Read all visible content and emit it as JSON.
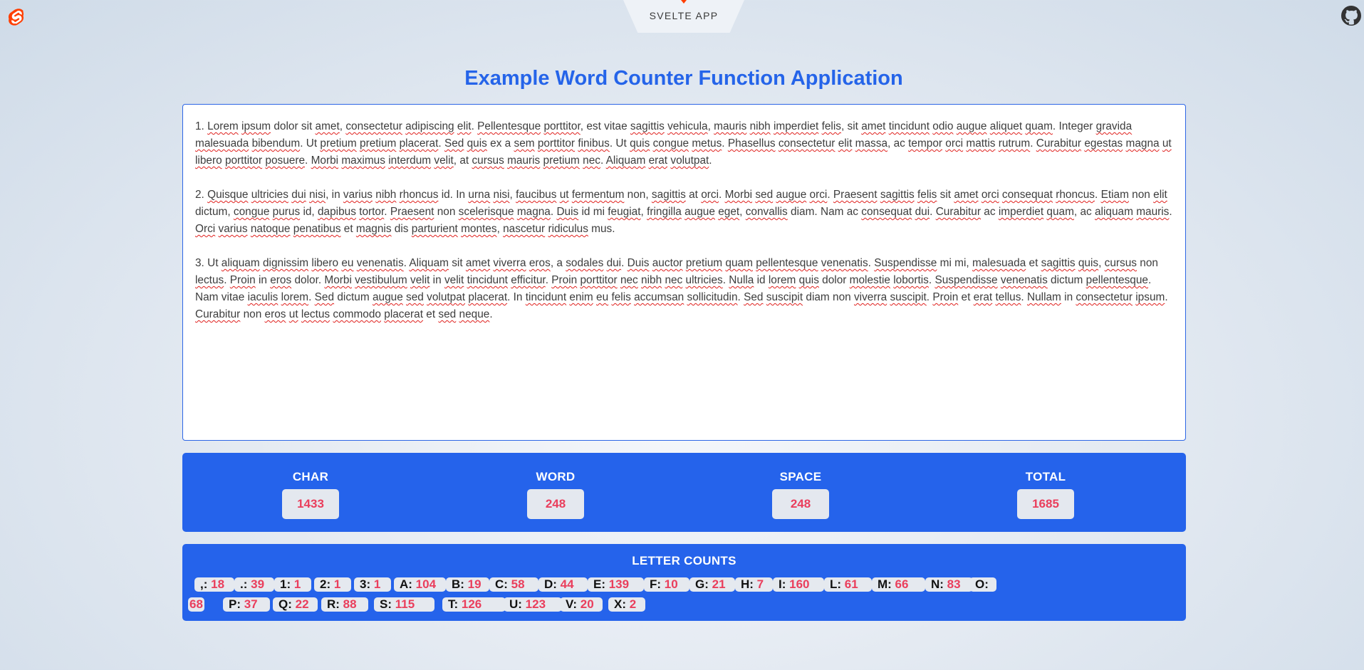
{
  "header": {
    "tab_label": "SVELTE APP",
    "brand_color": "#ff3e00",
    "logo_icon": "svelte-logo-icon",
    "repo_icon": "github-icon"
  },
  "page": {
    "title": "Example Word Counter Function Application",
    "accent_color": "#2563eb"
  },
  "editor": {
    "paragraphs": [
      [
        [
          "1. "
        ],
        [
          "Lorem",
          1
        ],
        [
          " "
        ],
        [
          "ipsum",
          1
        ],
        [
          " dolor sit "
        ],
        [
          "amet",
          1
        ],
        [
          ", "
        ],
        [
          "consectetur",
          1
        ],
        [
          " "
        ],
        [
          "adipiscing",
          1
        ],
        [
          " "
        ],
        [
          "elit",
          1
        ],
        [
          ". "
        ],
        [
          "Pellentesque",
          1
        ],
        [
          " "
        ],
        [
          "porttitor",
          1
        ],
        [
          ", est vitae "
        ],
        [
          "sagittis",
          1
        ],
        [
          " "
        ],
        [
          "vehicula",
          1
        ],
        [
          ", "
        ],
        [
          "mauris",
          1
        ],
        [
          " "
        ],
        [
          "nibh",
          1
        ],
        [
          " "
        ],
        [
          "imperdiet",
          1
        ],
        [
          " "
        ],
        [
          "felis",
          1
        ],
        [
          ", sit "
        ],
        [
          "amet",
          1
        ],
        [
          " "
        ],
        [
          "tincidunt",
          1
        ],
        [
          " "
        ],
        [
          "odio",
          1
        ],
        [
          " "
        ],
        [
          "augue",
          1
        ],
        [
          " "
        ],
        [
          "aliquet",
          1
        ],
        [
          " "
        ],
        [
          "quam",
          1
        ],
        [
          ". Integer "
        ],
        [
          "gravida",
          1
        ],
        [
          " "
        ],
        [
          "malesuada",
          1
        ],
        [
          " "
        ],
        [
          "bibendum",
          1
        ],
        [
          ". Ut "
        ],
        [
          "pretium",
          1
        ],
        [
          " "
        ],
        [
          "pretium",
          1
        ],
        [
          " "
        ],
        [
          "placerat",
          1
        ],
        [
          ". "
        ],
        [
          "Sed",
          1
        ],
        [
          " "
        ],
        [
          "quis",
          1
        ],
        [
          " ex a "
        ],
        [
          "sem",
          1
        ],
        [
          " "
        ],
        [
          "porttitor",
          1
        ],
        [
          " "
        ],
        [
          "finibus",
          1
        ],
        [
          ". Ut "
        ],
        [
          "quis",
          1
        ],
        [
          " "
        ],
        [
          "congue",
          1
        ],
        [
          " "
        ],
        [
          "metus",
          1
        ],
        [
          ". "
        ],
        [
          "Phasellus",
          1
        ],
        [
          " "
        ],
        [
          "consectetur",
          1
        ],
        [
          " "
        ],
        [
          "elit",
          1
        ],
        [
          " "
        ],
        [
          "massa",
          1
        ],
        [
          ", ac "
        ],
        [
          "tempor",
          1
        ],
        [
          " "
        ],
        [
          "orci",
          1
        ],
        [
          " "
        ],
        [
          "mattis",
          1
        ],
        [
          " "
        ],
        [
          "rutrum",
          1
        ],
        [
          ". "
        ],
        [
          "Curabitur",
          1
        ],
        [
          " "
        ],
        [
          "egestas",
          1
        ],
        [
          " "
        ],
        [
          "magna",
          1
        ],
        [
          " "
        ],
        [
          "ut",
          1
        ],
        [
          " "
        ],
        [
          "libero",
          1
        ],
        [
          " "
        ],
        [
          "porttitor",
          1
        ],
        [
          " "
        ],
        [
          "posuere",
          1
        ],
        [
          ". "
        ],
        [
          "Morbi",
          1
        ],
        [
          " "
        ],
        [
          "maximus",
          1
        ],
        [
          " "
        ],
        [
          "interdum",
          1
        ],
        [
          " "
        ],
        [
          "velit",
          1
        ],
        [
          ", at "
        ],
        [
          "cursus",
          1
        ],
        [
          " "
        ],
        [
          "mauris",
          1
        ],
        [
          " "
        ],
        [
          "pretium",
          1
        ],
        [
          " "
        ],
        [
          "nec",
          1
        ],
        [
          ". "
        ],
        [
          "Aliquam",
          1
        ],
        [
          " "
        ],
        [
          "erat",
          1
        ],
        [
          " "
        ],
        [
          "volutpat",
          1
        ],
        [
          "."
        ]
      ],
      [
        [
          "2. "
        ],
        [
          "Quisque",
          1
        ],
        [
          " "
        ],
        [
          "ultricies",
          1
        ],
        [
          " "
        ],
        [
          "dui",
          1
        ],
        [
          " "
        ],
        [
          "nisi",
          1
        ],
        [
          ", in "
        ],
        [
          "varius",
          1
        ],
        [
          " "
        ],
        [
          "nibh",
          1
        ],
        [
          " "
        ],
        [
          "rhoncus",
          1
        ],
        [
          " id. In "
        ],
        [
          "urna",
          1
        ],
        [
          " "
        ],
        [
          "nisi",
          1
        ],
        [
          ", "
        ],
        [
          "faucibus",
          1
        ],
        [
          " "
        ],
        [
          "ut",
          1
        ],
        [
          " "
        ],
        [
          "fermentum",
          1
        ],
        [
          " non, "
        ],
        [
          "sagittis",
          1
        ],
        [
          " at "
        ],
        [
          "orci",
          1
        ],
        [
          ". "
        ],
        [
          "Morbi",
          1
        ],
        [
          " "
        ],
        [
          "sed",
          1
        ],
        [
          " "
        ],
        [
          "augue",
          1
        ],
        [
          " "
        ],
        [
          "orci",
          1
        ],
        [
          ". "
        ],
        [
          "Praesent",
          1
        ],
        [
          " "
        ],
        [
          "sagittis",
          1
        ],
        [
          " "
        ],
        [
          "felis",
          1
        ],
        [
          " sit "
        ],
        [
          "amet",
          1
        ],
        [
          " "
        ],
        [
          "orci",
          1
        ],
        [
          " "
        ],
        [
          "consequat",
          1
        ],
        [
          " "
        ],
        [
          "rhoncus",
          1
        ],
        [
          ". "
        ],
        [
          "Etiam",
          1
        ],
        [
          " non "
        ],
        [
          "elit",
          1
        ],
        [
          " dictum, "
        ],
        [
          "congue",
          1
        ],
        [
          " "
        ],
        [
          "purus",
          1
        ],
        [
          " id, "
        ],
        [
          "dapibus",
          1
        ],
        [
          " "
        ],
        [
          "tortor",
          1
        ],
        [
          ". "
        ],
        [
          "Praesent",
          1
        ],
        [
          " non "
        ],
        [
          "scelerisque",
          1
        ],
        [
          " "
        ],
        [
          "magna",
          1
        ],
        [
          ". "
        ],
        [
          "Duis",
          1
        ],
        [
          " id mi "
        ],
        [
          "feugiat",
          1
        ],
        [
          ", "
        ],
        [
          "fringilla",
          1
        ],
        [
          " "
        ],
        [
          "augue",
          1
        ],
        [
          " "
        ],
        [
          "eget",
          1
        ],
        [
          ", "
        ],
        [
          "convallis",
          1
        ],
        [
          " diam. Nam ac "
        ],
        [
          "consequat",
          1
        ],
        [
          " "
        ],
        [
          "dui",
          1
        ],
        [
          ". "
        ],
        [
          "Curabitur",
          1
        ],
        [
          " ac "
        ],
        [
          "imperdiet",
          1
        ],
        [
          " "
        ],
        [
          "quam",
          1
        ],
        [
          ", ac "
        ],
        [
          "aliquam",
          1
        ],
        [
          " "
        ],
        [
          "mauris",
          1
        ],
        [
          ". "
        ],
        [
          "Orci",
          1
        ],
        [
          " "
        ],
        [
          "varius",
          1
        ],
        [
          " "
        ],
        [
          "natoque",
          1
        ],
        [
          " "
        ],
        [
          "penatibus",
          1
        ],
        [
          " et "
        ],
        [
          "magnis",
          1
        ],
        [
          " dis "
        ],
        [
          "parturient",
          1
        ],
        [
          " "
        ],
        [
          "montes",
          1
        ],
        [
          ", "
        ],
        [
          "nascetur",
          1
        ],
        [
          " "
        ],
        [
          "ridiculus",
          1
        ],
        [
          " mus."
        ]
      ],
      [
        [
          "3. Ut "
        ],
        [
          "aliquam",
          1
        ],
        [
          " "
        ],
        [
          "dignissim",
          1
        ],
        [
          " "
        ],
        [
          "libero",
          1
        ],
        [
          " "
        ],
        [
          "eu",
          1
        ],
        [
          " "
        ],
        [
          "venenatis",
          1
        ],
        [
          ". "
        ],
        [
          "Aliquam",
          1
        ],
        [
          " sit "
        ],
        [
          "amet",
          1
        ],
        [
          " "
        ],
        [
          "viverra",
          1
        ],
        [
          " "
        ],
        [
          "eros",
          1
        ],
        [
          ", a "
        ],
        [
          "sodales",
          1
        ],
        [
          " "
        ],
        [
          "dui",
          1
        ],
        [
          ". "
        ],
        [
          "Duis",
          1
        ],
        [
          " "
        ],
        [
          "auctor",
          1
        ],
        [
          " "
        ],
        [
          "pretium",
          1
        ],
        [
          " "
        ],
        [
          "quam",
          1
        ],
        [
          " "
        ],
        [
          "pellentesque",
          1
        ],
        [
          " "
        ],
        [
          "venenatis",
          1
        ],
        [
          ". "
        ],
        [
          "Suspendisse",
          1
        ],
        [
          " mi mi, "
        ],
        [
          "malesuada",
          1
        ],
        [
          " et "
        ],
        [
          "sagittis",
          1
        ],
        [
          " "
        ],
        [
          "quis",
          1
        ],
        [
          ", "
        ],
        [
          "cursus",
          1
        ],
        [
          " non "
        ],
        [
          "lectus",
          1
        ],
        [
          ". "
        ],
        [
          "Proin",
          1
        ],
        [
          " in "
        ],
        [
          "eros",
          1
        ],
        [
          " dolor. "
        ],
        [
          "Morbi",
          1
        ],
        [
          " "
        ],
        [
          "vestibulum",
          1
        ],
        [
          " "
        ],
        [
          "velit",
          1
        ],
        [
          " in "
        ],
        [
          "velit",
          1
        ],
        [
          " "
        ],
        [
          "tincidunt",
          1
        ],
        [
          " "
        ],
        [
          "efficitur",
          1
        ],
        [
          ". "
        ],
        [
          "Proin",
          1
        ],
        [
          " "
        ],
        [
          "porttitor",
          1
        ],
        [
          " "
        ],
        [
          "nec",
          1
        ],
        [
          " "
        ],
        [
          "nibh",
          1
        ],
        [
          " "
        ],
        [
          "nec",
          1
        ],
        [
          " "
        ],
        [
          "ultricies",
          1
        ],
        [
          ". "
        ],
        [
          "Nulla",
          1
        ],
        [
          " id "
        ],
        [
          "lorem",
          1
        ],
        [
          " "
        ],
        [
          "quis",
          1
        ],
        [
          " dolor "
        ],
        [
          "molestie",
          1
        ],
        [
          " "
        ],
        [
          "lobortis",
          1
        ],
        [
          ". "
        ],
        [
          "Suspendisse",
          1
        ],
        [
          " "
        ],
        [
          "venenatis",
          1
        ],
        [
          " dictum "
        ],
        [
          "pellentesque",
          1
        ],
        [
          ". Nam vitae "
        ],
        [
          "iaculis",
          1
        ],
        [
          " "
        ],
        [
          "lorem",
          1
        ],
        [
          ". "
        ],
        [
          "Sed",
          1
        ],
        [
          " dictum "
        ],
        [
          "augue",
          1
        ],
        [
          " "
        ],
        [
          "sed",
          1
        ],
        [
          " "
        ],
        [
          "volutpat",
          1
        ],
        [
          " "
        ],
        [
          "placerat",
          1
        ],
        [
          ". In "
        ],
        [
          "tincidunt",
          1
        ],
        [
          " "
        ],
        [
          "enim",
          1
        ],
        [
          " "
        ],
        [
          "eu",
          1
        ],
        [
          " "
        ],
        [
          "felis",
          1
        ],
        [
          " "
        ],
        [
          "accumsan",
          1
        ],
        [
          " "
        ],
        [
          "sollicitudin",
          1
        ],
        [
          ". "
        ],
        [
          "Sed",
          1
        ],
        [
          " "
        ],
        [
          "suscipit",
          1
        ],
        [
          " diam non "
        ],
        [
          "viverra",
          1
        ],
        [
          " "
        ],
        [
          "suscipit",
          1
        ],
        [
          ". "
        ],
        [
          "Proin",
          1
        ],
        [
          " et "
        ],
        [
          "erat",
          1
        ],
        [
          " "
        ],
        [
          "tellus",
          1
        ],
        [
          ". "
        ],
        [
          "Nullam",
          1
        ],
        [
          " in "
        ],
        [
          "consectetur",
          1
        ],
        [
          " "
        ],
        [
          "ipsum",
          1
        ],
        [
          ". "
        ],
        [
          "Curabitur",
          1
        ],
        [
          " non "
        ],
        [
          "eros",
          1
        ],
        [
          " "
        ],
        [
          "ut",
          1
        ],
        [
          " "
        ],
        [
          "lectus",
          1
        ],
        [
          " "
        ],
        [
          "commodo",
          1
        ],
        [
          " "
        ],
        [
          "placerat",
          1
        ],
        [
          " et "
        ],
        [
          "sed",
          1
        ],
        [
          " "
        ],
        [
          "neque",
          1
        ],
        [
          "."
        ]
      ]
    ]
  },
  "stats": [
    {
      "label": "CHAR",
      "value": "1433"
    },
    {
      "label": "WORD",
      "value": "248"
    },
    {
      "label": "SPACE",
      "value": "248"
    },
    {
      "label": "TOTAL",
      "value": "1685"
    }
  ],
  "letter_counts": {
    "title": "LETTER COUNTS",
    "items": [
      {
        "key": ",:",
        "value": "18"
      },
      {
        "key": ".:",
        "value": "39"
      },
      {
        "key": "1:",
        "value": "1"
      },
      {
        "key": "2:",
        "value": "1"
      },
      {
        "key": "3:",
        "value": "1"
      },
      {
        "key": "A:",
        "value": "104"
      },
      {
        "key": "B:",
        "value": "19"
      },
      {
        "key": "C:",
        "value": "58"
      },
      {
        "key": "D:",
        "value": "44"
      },
      {
        "key": "E:",
        "value": "139"
      },
      {
        "key": "F:",
        "value": "10"
      },
      {
        "key": "G:",
        "value": "21"
      },
      {
        "key": "H:",
        "value": "7"
      },
      {
        "key": "I:",
        "value": "160"
      },
      {
        "key": "L:",
        "value": "61"
      },
      {
        "key": "M:",
        "value": "66"
      },
      {
        "key": "N:",
        "value": "83"
      },
      {
        "key": "O:",
        "value": "68"
      },
      {
        "key": "P:",
        "value": "37"
      },
      {
        "key": "Q:",
        "value": "22"
      },
      {
        "key": "R:",
        "value": "88"
      },
      {
        "key": "S:",
        "value": "115"
      },
      {
        "key": "T:",
        "value": "126"
      },
      {
        "key": "U:",
        "value": "123"
      },
      {
        "key": "V:",
        "value": "20"
      },
      {
        "key": "X:",
        "value": "2"
      }
    ]
  }
}
